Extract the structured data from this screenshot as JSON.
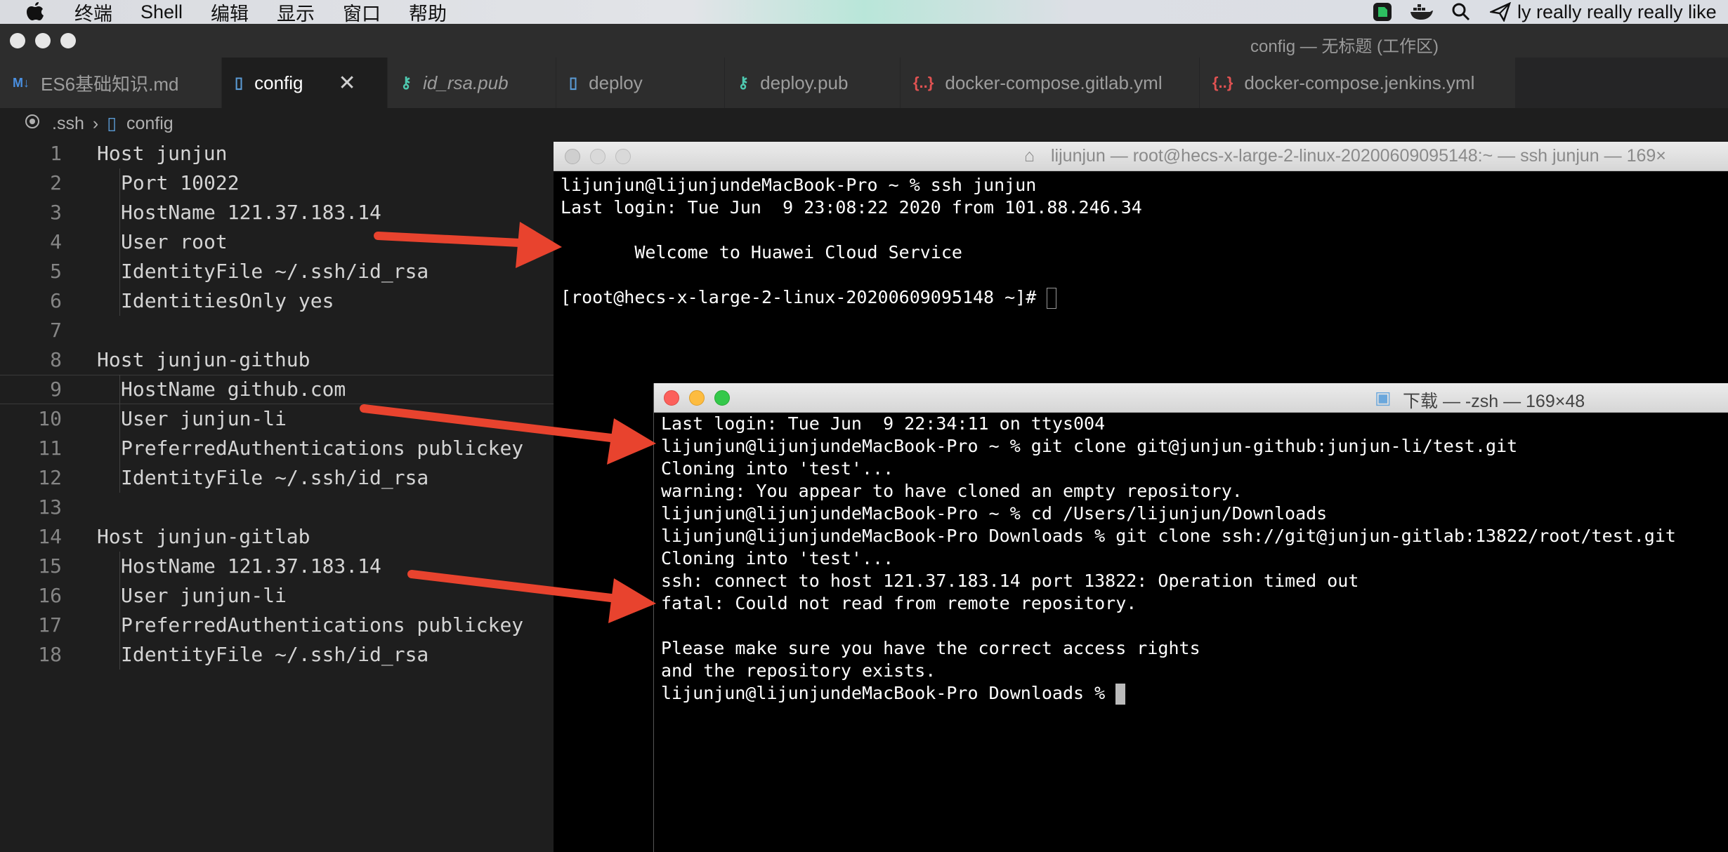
{
  "menubar": {
    "items": [
      "终端",
      "Shell",
      "编辑",
      "显示",
      "窗口",
      "帮助"
    ],
    "status_text": "ly really really really like"
  },
  "vscode": {
    "window_title": "config — 无标题 (工作区)",
    "tabs": [
      {
        "label": "ES6基础知识.md",
        "icon": "markdown-icon",
        "icon_text": "M↓"
      },
      {
        "label": "config",
        "icon": "file-icon",
        "icon_text": "▯",
        "close": "✕"
      },
      {
        "label": "id_rsa.pub",
        "icon": "key-icon",
        "icon_text": "⚷"
      },
      {
        "label": "deploy",
        "icon": "file-icon",
        "icon_text": "▯"
      },
      {
        "label": "deploy.pub",
        "icon": "key-icon",
        "icon_text": "⚷"
      },
      {
        "label": "docker-compose.gitlab.yml",
        "icon": "braces-icon",
        "icon_text": "{..}"
      },
      {
        "label": "docker-compose.jenkins.yml",
        "icon": "braces-icon",
        "icon_text": "{..}"
      }
    ],
    "breadcrumb": {
      "folder": ".ssh",
      "separator": "›",
      "file": "config"
    },
    "lines": [
      {
        "n": "1",
        "text": "Host junjun"
      },
      {
        "n": "2",
        "text": "Port 10022"
      },
      {
        "n": "3",
        "text": "HostName 121.37.183.14"
      },
      {
        "n": "4",
        "text": "User root"
      },
      {
        "n": "5",
        "text": "IdentityFile ~/.ssh/id_rsa"
      },
      {
        "n": "6",
        "text": "IdentitiesOnly yes"
      },
      {
        "n": "7",
        "text": ""
      },
      {
        "n": "8",
        "text": "Host junjun-github"
      },
      {
        "n": "9",
        "text": "HostName github.com"
      },
      {
        "n": "10",
        "text": "User junjun-li"
      },
      {
        "n": "11",
        "text": "PreferredAuthentications publickey"
      },
      {
        "n": "12",
        "text": "IdentityFile ~/.ssh/id_rsa"
      },
      {
        "n": "13",
        "text": ""
      },
      {
        "n": "14",
        "text": "Host junjun-gitlab"
      },
      {
        "n": "15",
        "text": "HostName 121.37.183.14"
      },
      {
        "n": "16",
        "text": "User junjun-li"
      },
      {
        "n": "17",
        "text": "PreferredAuthentications publickey"
      },
      {
        "n": "18",
        "text": "IdentityFile ~/.ssh/id_rsa"
      }
    ]
  },
  "terminal1": {
    "title": "lijunjun — root@hecs-x-large-2-linux-20200609095148:~ — ssh junjun — 169×",
    "lines": [
      "lijunjun@lijunjundeMacBook-Pro ~ % ssh junjun",
      "Last login: Tue Jun  9 23:08:22 2020 from 101.88.246.34",
      "",
      "       Welcome to Huawei Cloud Service",
      "",
      "[root@hecs-x-large-2-linux-20200609095148 ~]# "
    ]
  },
  "terminal2": {
    "title": "下载 — -zsh — 169×48",
    "lines": [
      "Last login: Tue Jun  9 22:34:11 on ttys004",
      "lijunjun@lijunjundeMacBook-Pro ~ % git clone git@junjun-github:junjun-li/test.git",
      "Cloning into 'test'...",
      "warning: You appear to have cloned an empty repository.",
      "lijunjun@lijunjundeMacBook-Pro ~ % cd /Users/lijunjun/Downloads",
      "lijunjun@lijunjundeMacBook-Pro Downloads % git clone ssh://git@junjun-gitlab:13822/root/test.git",
      "Cloning into 'test'...",
      "ssh: connect to host 121.37.183.14 port 13822: Operation timed out",
      "fatal: Could not read from remote repository.",
      "",
      "Please make sure you have the correct access rights",
      "and the repository exists.",
      "lijunjun@lijunjundeMacBook-Pro Downloads % "
    ]
  },
  "colors": {
    "arrow": "#e8432e",
    "close": "#fc605b",
    "minimize": "#fdbc40",
    "zoom": "#34c84a"
  }
}
